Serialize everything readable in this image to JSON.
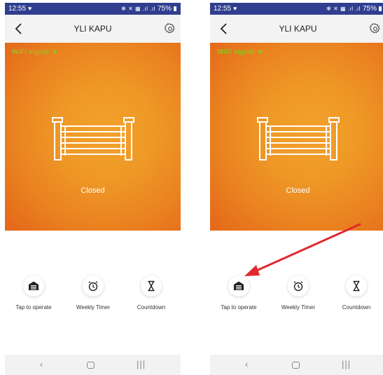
{
  "panels": [
    {
      "status_bar": {
        "time": "12:55",
        "battery": "75%"
      },
      "app_bar": {
        "title": "YLI KAPU"
      },
      "wifi_label": "WiFi signal",
      "gate_status": "Closed",
      "controls": [
        {
          "label": "Tap to operate",
          "icon": "garage-icon"
        },
        {
          "label": "Weekly Timer",
          "icon": "alarm-clock-icon"
        },
        {
          "label": "Countdown",
          "icon": "hourglass-icon"
        }
      ]
    },
    {
      "status_bar": {
        "time": "12:55",
        "battery": "75%"
      },
      "app_bar": {
        "title": "YLI KAPU"
      },
      "wifi_label": "WiFi signal",
      "gate_status": "Closed",
      "controls": [
        {
          "label": "Tap to operate",
          "icon": "garage-icon"
        },
        {
          "label": "Weekly Timer",
          "icon": "alarm-clock-icon"
        },
        {
          "label": "Countdown",
          "icon": "hourglass-icon"
        }
      ]
    }
  ],
  "colors": {
    "status_bar": "#2f3e8f",
    "hero_orange": "#ea8320",
    "wifi_green": "#9bbd1c",
    "annotation_arrow": "#e0282e"
  }
}
